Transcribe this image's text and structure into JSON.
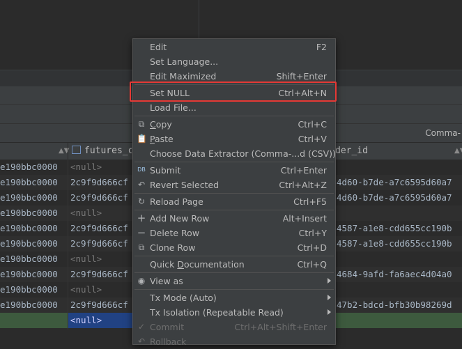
{
  "menu": {
    "items": [
      {
        "label": "Edit",
        "shortcut": "F2"
      },
      {
        "label": "Set Language...",
        "shortcut": ""
      },
      {
        "label": "Edit Maximized",
        "shortcut": "Shift+Enter"
      },
      {
        "label": "Set NULL",
        "shortcut": "Ctrl+Alt+N"
      },
      {
        "label": "Load File...",
        "shortcut": ""
      },
      {
        "label": "Copy",
        "shortcut": "Ctrl+C"
      },
      {
        "label": "Paste",
        "shortcut": "Ctrl+V"
      },
      {
        "label": "Choose Data Extractor (Comma-...d (CSV))",
        "shortcut": ""
      },
      {
        "label": "Submit",
        "shortcut": "Ctrl+Enter"
      },
      {
        "label": "Revert Selected",
        "shortcut": "Ctrl+Alt+Z"
      },
      {
        "label": "Reload Page",
        "shortcut": "Ctrl+F5"
      },
      {
        "label": "Add New Row",
        "shortcut": "Alt+Insert"
      },
      {
        "label": "Delete Row",
        "shortcut": "Ctrl+Y"
      },
      {
        "label": "Clone Row",
        "shortcut": "Ctrl+D"
      },
      {
        "label": "Quick Documentation",
        "shortcut": "Ctrl+Q"
      },
      {
        "label": "View as",
        "shortcut": ""
      },
      {
        "label": "Tx Mode (Auto)",
        "shortcut": ""
      },
      {
        "label": "Tx Isolation (Repeatable Read)",
        "shortcut": ""
      },
      {
        "label": "Commit",
        "shortcut": "Ctrl+Alt+Shift+Enter"
      },
      {
        "label": "Rollback",
        "shortcut": ""
      }
    ]
  },
  "toolbar": {
    "extractor": "Comma-"
  },
  "table": {
    "headers": {
      "col2": "futures_c",
      "col3": "der_id"
    },
    "rows": [
      {
        "c1": "e190bbc0000",
        "c2": "<null>",
        "c3": ""
      },
      {
        "c1": "e190bbc0000",
        "c2": "2c9f9d666cf",
        "c3": "4d60-b7de-a7c6595d60a7"
      },
      {
        "c1": "e190bbc0000",
        "c2": "2c9f9d666cf",
        "c3": "4d60-b7de-a7c6595d60a7"
      },
      {
        "c1": "e190bbc0000",
        "c2": "<null>",
        "c3": ""
      },
      {
        "c1": "e190bbc0000",
        "c2": "2c9f9d666cf",
        "c3": "4587-a1e8-cdd655cc190b"
      },
      {
        "c1": "e190bbc0000",
        "c2": "2c9f9d666cf",
        "c3": "4587-a1e8-cdd655cc190b"
      },
      {
        "c1": "e190bbc0000",
        "c2": "<null>",
        "c3": ""
      },
      {
        "c1": "e190bbc0000",
        "c2": "2c9f9d666cf",
        "c3": "4684-9afd-fa6aec4d04a0"
      },
      {
        "c1": "e190bbc0000",
        "c2": "<null>",
        "c3": ""
      },
      {
        "c1": "e190bbc0000",
        "c2": "2c9f9d666cf",
        "c3": "47b2-bdcd-bfb30b98269d"
      },
      {
        "c1": "",
        "c2": "<null>",
        "c3": ""
      }
    ]
  }
}
